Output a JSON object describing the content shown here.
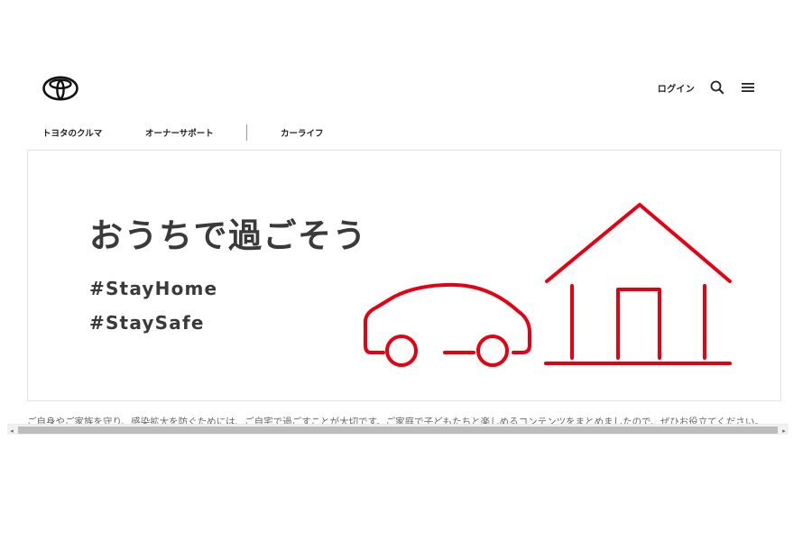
{
  "header": {
    "logo_icon": "toyota-emblem-icon",
    "login_label": "ログイン",
    "search_icon": "search-icon",
    "menu_icon": "hamburger-menu-icon"
  },
  "nav": {
    "items": [
      {
        "label": "トヨタのクルマ"
      },
      {
        "label": "オーナーサポート"
      },
      {
        "label": "カーライフ"
      }
    ]
  },
  "hero": {
    "title": "おうちで過ごそう",
    "hashtags": [
      "#StayHome",
      "#StaySafe"
    ],
    "illustration_icon": "car-and-house-icon",
    "accent_color": "#e60012"
  },
  "intro": {
    "text": "ご自身やご家族を守り、感染拡大を防ぐためには、ご自宅で過ごすことが大切です。ご家庭で子どもたちと楽しめるコンテンツをまとめましたので、ぜひお役立てください。"
  },
  "scrollbar": {
    "left_arrow": "◂",
    "right_arrow": "▸"
  }
}
